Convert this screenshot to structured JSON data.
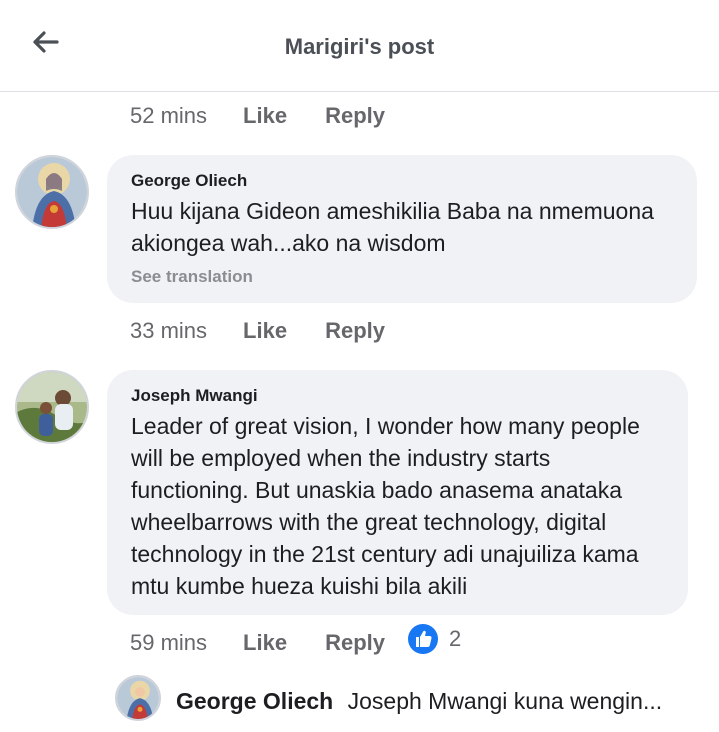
{
  "header": {
    "title": "Marigiri's post",
    "back_icon": "arrow-left-icon"
  },
  "top_actions": {
    "time": "52 mins",
    "like": "Like",
    "reply": "Reply"
  },
  "comments": [
    {
      "author": "George Oliech",
      "text": "Huu kijana Gideon ameshikilia Baba na nmemuona akiongea wah...ako na wisdom",
      "see_translation": "See translation",
      "time": "33 mins",
      "like": "Like",
      "reply": "Reply"
    },
    {
      "author": "Joseph Mwangi",
      "text": "Leader of great vision, I wonder how many people will be employed when the industry starts functioning. But unaskia bado anasema anataka wheelbarrows with the great technology, digital technology in the 21st century adi unajuiliza kama mtu kumbe hueza kuishi bila akili",
      "time": "59 mins",
      "like": "Like",
      "reply": "Reply",
      "reaction_count": "2",
      "reaction_icon": "thumbs-up-icon"
    }
  ],
  "reply_preview": {
    "author": "George Oliech",
    "text": "Joseph Mwangi kuna wengin..."
  },
  "colors": {
    "like_blue": "#1877f2",
    "bubble_bg": "#f0f2f5",
    "muted": "#65676b"
  }
}
